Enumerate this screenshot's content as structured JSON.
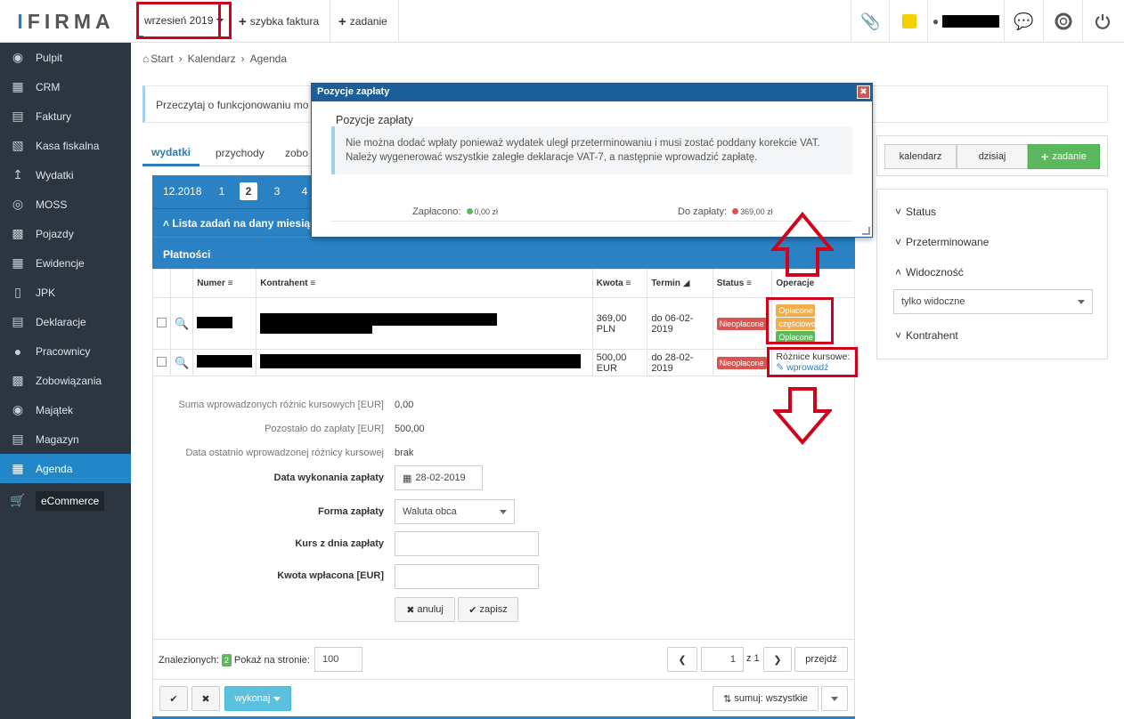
{
  "brand": {
    "name": "IFIRMA"
  },
  "topbar": {
    "month_selector": "wrzesień 2019",
    "quick_invoice": "szybka faktura",
    "task": "zadanie"
  },
  "sidebar": {
    "items": [
      {
        "label": "Pulpit",
        "icon": "dashboard-icon"
      },
      {
        "label": "CRM",
        "icon": "contacts-icon"
      },
      {
        "label": "Faktury",
        "icon": "invoice-icon"
      },
      {
        "label": "Kasa fiskalna",
        "icon": "cash-register-icon"
      },
      {
        "label": "Wydatki",
        "icon": "upload-icon"
      },
      {
        "label": "MOSS",
        "icon": "disc-icon"
      },
      {
        "label": "Pojazdy",
        "icon": "truck-icon"
      },
      {
        "label": "Ewidencje",
        "icon": "table-icon"
      },
      {
        "label": "JPK",
        "icon": "document-icon"
      },
      {
        "label": "Deklaracje",
        "icon": "declaration-icon"
      },
      {
        "label": "Pracownicy",
        "icon": "user-icon"
      },
      {
        "label": "Zobowiązania",
        "icon": "liabilities-icon"
      },
      {
        "label": "Majątek",
        "icon": "camera-icon"
      },
      {
        "label": "Magazyn",
        "icon": "warehouse-icon"
      },
      {
        "label": "Agenda",
        "icon": "calendar-grid-icon"
      },
      {
        "label": "eCommerce",
        "icon": "cart-icon"
      }
    ],
    "active": "Agenda"
  },
  "breadcrumb": {
    "items": [
      "Start",
      "Kalendarz",
      "Agenda"
    ]
  },
  "notice": {
    "text": "Przeczytaj o funkcjonowaniu mo"
  },
  "tabs": {
    "items": [
      "wydatki",
      "przychody",
      "zobo"
    ],
    "active": "wydatki"
  },
  "months": {
    "items": [
      "12.2018",
      "1",
      "2",
      "3",
      "4"
    ],
    "current": "2"
  },
  "bars": {
    "tasks": "Lista zadań na dany miesiąc",
    "payments": "Płatności"
  },
  "table": {
    "headers": {
      "number": "Numer",
      "contractor": "Kontrahent",
      "amount": "Kwota",
      "due": "Termin",
      "status": "Status",
      "operations": "Operacje"
    },
    "rows": [
      {
        "amount": "369,00 PLN",
        "due": "do 06-02-2019",
        "status": "Nieopłacone",
        "op_badges": [
          "Opłacone",
          "częściowo",
          "Opłacone"
        ]
      },
      {
        "amount": "500,00 EUR",
        "due": "do 28-02-2019",
        "status": "Nieopłacone",
        "op_label": "Różnice kursowe:",
        "op_link": "wprowadź"
      }
    ]
  },
  "form": {
    "sum_label": "Suma wprowadzonych różnic kursowych [EUR]",
    "sum_value": "0,00",
    "remaining_label": "Pozostało do zapłaty [EUR]",
    "remaining_value": "500,00",
    "lastdate_label": "Data ostatnio wprowadzonej różnicy kursowej",
    "lastdate_value": "brak",
    "paydate_label": "Data wykonania zapłaty",
    "paydate_value": "28-02-2019",
    "form_label": "Forma zapłaty",
    "form_value": "Waluta obca",
    "rate_label": "Kurs z dnia zapłaty",
    "paid_label": "Kwota wpłacona [EUR]",
    "cancel": "anuluj",
    "save": "zapisz"
  },
  "footer": {
    "found_label": "Znalezionych:",
    "found_count": "2",
    "per_page_label": "Pokaż na stronie:",
    "per_page_value": "100",
    "page_value": "1",
    "page_of": "z 1",
    "go": "przejdź",
    "execute": "wykonaj",
    "sum": "sumuj: wszystkie"
  },
  "right": {
    "calendar": "kalendarz",
    "today": "dzisiaj",
    "add_task": "zadanie",
    "filters": [
      "Status",
      "Przeterminowane",
      "Widoczność",
      "Kontrahent"
    ],
    "visibility_value": "tylko widoczne"
  },
  "modal": {
    "title": "Pozycje zapłaty",
    "subtitle": "Pozycje zapłaty",
    "message": "Nie można dodać wpłaty ponieważ wydatek uległ przeterminowaniu i musi zostać poddany korekcie VAT. Należy wygenerować wszystkie zaległe deklaracje VAT-7, a następnie wprowadzić zapłatę.",
    "paid_label": "Zapłacono:",
    "paid_value": "0,00 zł",
    "topay_label": "Do zapłaty:",
    "topay_value": "369,00 zł"
  },
  "colors": {
    "primary": "#2a82c4",
    "active_nav": "#2187c9",
    "sidebar": "#2c3540",
    "success": "#5cb85c",
    "danger": "#d9534f",
    "warning": "#f0ad4e",
    "highlight": "#d0021b"
  }
}
